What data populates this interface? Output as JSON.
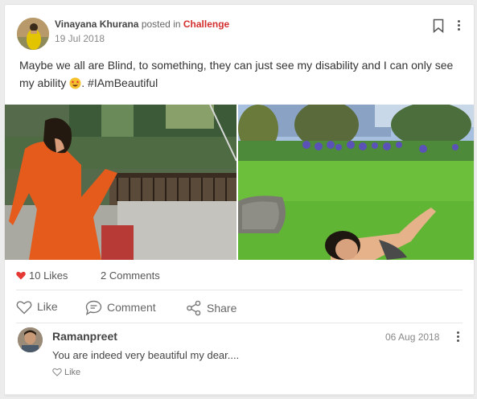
{
  "post": {
    "author": "Vinayana Khurana",
    "posted_in": "posted in",
    "channel": "Challenge",
    "date": "19 Jul 2018",
    "text_before_emoji": "Maybe we all are Blind, to something, they can just see my disability and I can only see my ability",
    "text_after_emoji": ".  #IAmBeautiful",
    "emoji": "star-struck-emoji",
    "accent_color": "#d32f2f"
  },
  "stats": {
    "likes": "10 Likes",
    "comments": "2 Comments"
  },
  "actions": {
    "like": "Like",
    "comment": "Comment",
    "share": "Share"
  },
  "comment": {
    "author": "Ramanpreet",
    "date": "06 Aug 2018",
    "text": "You are indeed very beautiful my dear....",
    "like": "Like"
  },
  "icons": [
    "bookmark-icon",
    "more-vertical-icon",
    "heart-icon",
    "like-icon",
    "comment-icon",
    "share-icon"
  ]
}
